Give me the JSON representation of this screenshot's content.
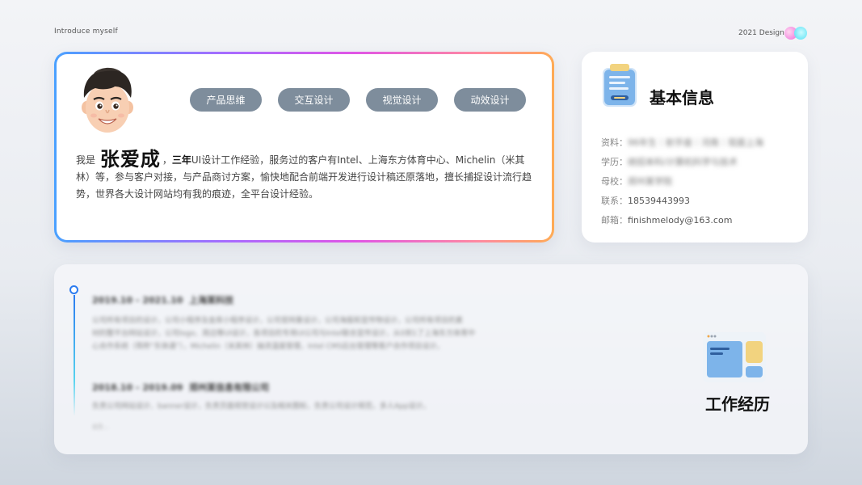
{
  "header": {
    "left_caption": "Introduce myself",
    "right_caption": "2021 Design"
  },
  "profile": {
    "tags": [
      "产品思维",
      "交互设计",
      "视觉设计",
      "动效设计"
    ],
    "intro_prefix": "我是",
    "name": "张爱成",
    "intro_sep": "，",
    "years": "三年",
    "intro_text": "UI设计工作经验，服务过的客户有Intel、上海东方体育中心、Michelin（米其林）等，参与客户对接，与产品商讨方案，愉快地配合前端开发进行设计稿还原落地，擅长捕捉设计流行趋势，世界各大设计网站均有我的痕迹，全平台设计经验。"
  },
  "basic_info": {
    "title": "基本信息",
    "rows": [
      {
        "label": "资料：",
        "value": "96年生｜射手座｜河南｜现居上海",
        "blurred": true
      },
      {
        "label": "学历：",
        "value": "统招本科/计算机科学与技术",
        "blurred": true
      },
      {
        "label": "母校：",
        "value": "郑州某学院",
        "blurred": true
      },
      {
        "label": "联系：",
        "value": "18539443993",
        "blurred": false
      },
      {
        "label": "邮箱：",
        "value": "finishmelody@163.com",
        "blurred": false
      }
    ]
  },
  "work": {
    "title": "工作经历",
    "entries": [
      {
        "period": "2019.10 - 2021.10",
        "company": "上海某科技",
        "lines": [
          "公司所有项目的设计，公司小程序及金库小程序设计，公司官网重设计，公司海报和宣传物设计，公司所有项目的素",
          "材的整平台网站设计，公司logo、周边等UI设计，各项目的专用UI公司与Intel联合宣传设计，从0到1了上海东方体育中",
          "心合作系统（简称“东体通”），Michelin（米其林）抽流温度管理，Intel CMS后台管理等客户合作项目设计。"
        ]
      },
      {
        "period": "2018.10 - 2019.09",
        "company": "郑州某信息有限公司",
        "lines": [
          "负责公司网站设计、banner设计，负责页面视觉设计以及相关图标，负责公司设计规范，多人App设计。"
        ]
      }
    ],
    "footnote": "出生..."
  },
  "colors": {
    "tag_bg": "#7e8d9c",
    "timeline_accent": "#2b7bf0",
    "border_gradient": [
      "#4aa1ff",
      "#a86bff",
      "#e055e6",
      "#ff8aa0",
      "#ffab55"
    ]
  }
}
